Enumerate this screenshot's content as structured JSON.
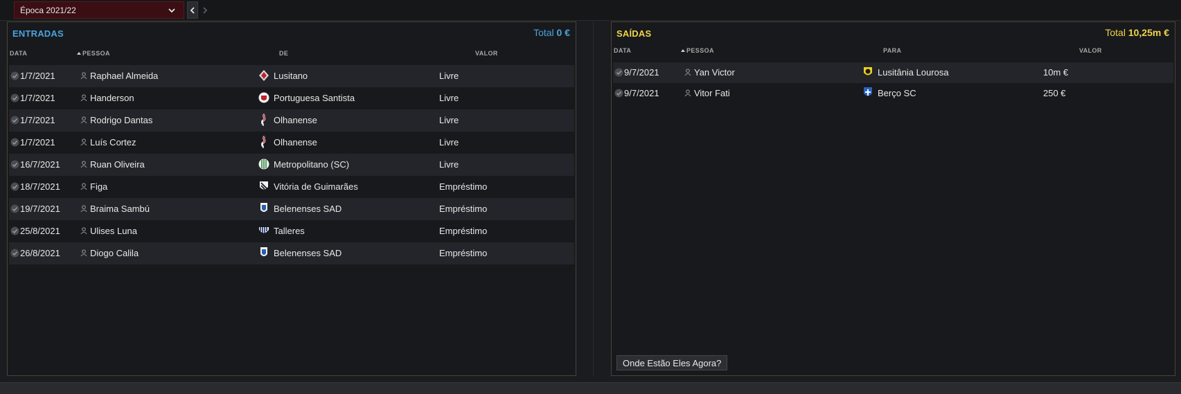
{
  "season": {
    "selected": "Época 2021/22"
  },
  "colors": {
    "incoming_accent": "#4aa3df",
    "outgoing_accent": "#f0d54a",
    "season_select_bg": "#3a0e12"
  },
  "incoming": {
    "title": "ENTRADAS",
    "total_label": "Total",
    "total_value": "0 €",
    "columns": {
      "date": "DATA",
      "person": "PESSOA",
      "from": "DE",
      "value": "VALOR"
    },
    "rows": [
      {
        "date": "1/7/2021",
        "person": "Raphael Almeida",
        "club": "Lusitano",
        "value": "Livre",
        "crest": "lusitano-crest-icon"
      },
      {
        "date": "1/7/2021",
        "person": "Handerson",
        "club": "Portuguesa Santista",
        "value": "Livre",
        "crest": "portuguesa-santista-crest-icon"
      },
      {
        "date": "1/7/2021",
        "person": "Rodrigo Dantas",
        "club": "Olhanense",
        "value": "Livre",
        "crest": "olhanense-crest-icon"
      },
      {
        "date": "1/7/2021",
        "person": "Luís Cortez",
        "club": "Olhanense",
        "value": "Livre",
        "crest": "olhanense-crest-icon"
      },
      {
        "date": "16/7/2021",
        "person": "Ruan Oliveira",
        "club": "Metropolitano (SC)",
        "value": "Livre",
        "crest": "metropolitano-crest-icon"
      },
      {
        "date": "18/7/2021",
        "person": "Figa",
        "club": "Vitória de Guimarães",
        "value": "Empréstimo",
        "crest": "vitoria-guimaraes-crest-icon"
      },
      {
        "date": "19/7/2021",
        "person": "Braima Sambú",
        "club": "Belenenses SAD",
        "value": "Empréstimo",
        "crest": "belenenses-crest-icon"
      },
      {
        "date": "25/8/2021",
        "person": "Ulises Luna",
        "club": "Talleres",
        "value": "Empréstimo",
        "crest": "talleres-crest-icon"
      },
      {
        "date": "26/8/2021",
        "person": "Diogo Calila",
        "club": "Belenenses SAD",
        "value": "Empréstimo",
        "crest": "belenenses-crest-icon"
      }
    ]
  },
  "outgoing": {
    "title": "SAÍDAS",
    "total_label": "Total",
    "total_value": "10,25m €",
    "columns": {
      "date": "DATA",
      "person": "PESSOA",
      "to": "PARA",
      "value": "VALOR"
    },
    "rows": [
      {
        "date": "9/7/2021",
        "person": "Yan Victor",
        "club": "Lusitânia Lourosa",
        "value": "10m €",
        "crest": "lusitania-lourosa-crest-icon"
      },
      {
        "date": "9/7/2021",
        "person": "Vitor Fati",
        "club": "Berço SC",
        "value": "250 €",
        "crest": "berco-sc-crest-icon"
      }
    ],
    "where_button": "Onde Estão Eles Agora?"
  }
}
